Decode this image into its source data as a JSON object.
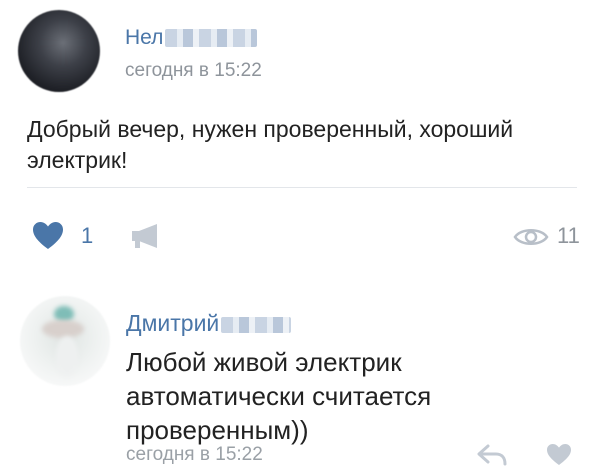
{
  "post": {
    "author": "Нел",
    "time": "сегодня в 15:22",
    "text": "Добрый вечер, нужен проверенный, хороший электрик!",
    "likes": "1",
    "views": "11"
  },
  "comment": {
    "author": "Дмитрий",
    "text": "Любой живой электрик автоматически считается проверенным))",
    "time": "сегодня в 15:22"
  },
  "colors": {
    "link": "#4a76a8",
    "muted": "#8e949b",
    "like_active": "#4a76a8",
    "icon_inactive": "#c3cad3"
  },
  "icons": {
    "like": "heart-icon",
    "share": "megaphone-icon",
    "views": "eye-icon",
    "reply": "reply-arrow-icon",
    "comment_like": "heart-outline-icon"
  }
}
